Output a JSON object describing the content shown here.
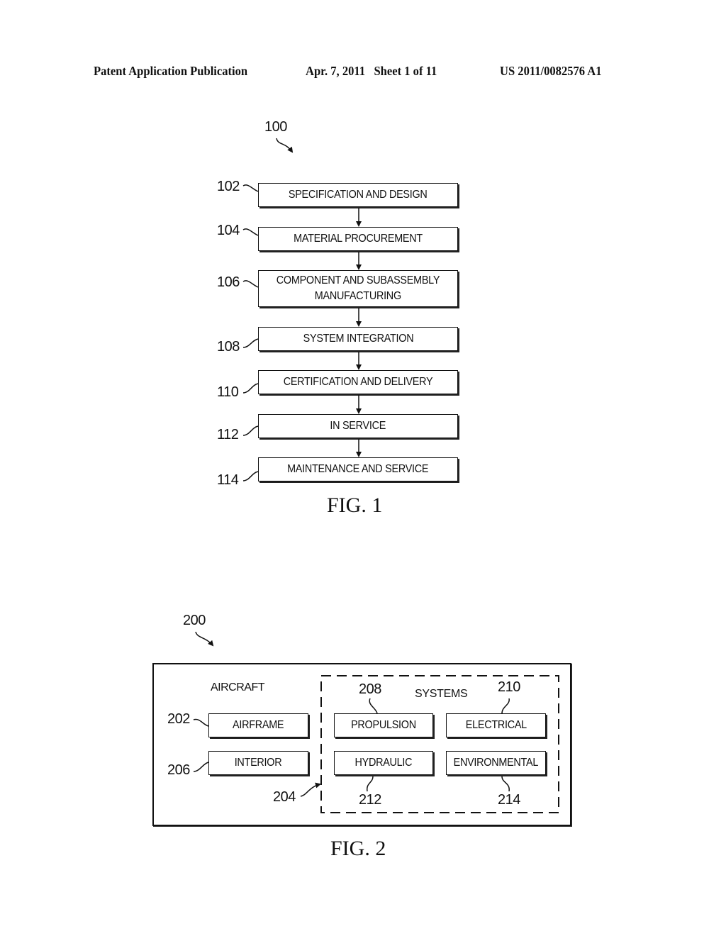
{
  "header": {
    "publication": "Patent Application Publication",
    "date_sheet": "Apr. 7, 2011   Sheet 1 of 11",
    "number": "US 2011/0082576 A1"
  },
  "fig1": {
    "ref": "100",
    "caption": "FIG. 1",
    "steps": [
      {
        "ref": "102",
        "label": "SPECIFICATION AND DESIGN"
      },
      {
        "ref": "104",
        "label": "MATERIAL PROCUREMENT"
      },
      {
        "ref": "106",
        "label": "COMPONENT AND SUBASSEMBLY",
        "label2": "MANUFACTURING"
      },
      {
        "ref": "108",
        "label": "SYSTEM INTEGRATION"
      },
      {
        "ref": "110",
        "label": "CERTIFICATION AND DELIVERY"
      },
      {
        "ref": "112",
        "label": "IN SERVICE"
      },
      {
        "ref": "114",
        "label": "MAINTENANCE AND SERVICE"
      }
    ]
  },
  "fig2": {
    "ref": "200",
    "caption": "FIG. 2",
    "aircraft_label": "AIRCRAFT",
    "systems_label": "SYSTEMS",
    "systems_ref": "204",
    "airframe": {
      "ref": "202",
      "label": "AIRFRAME"
    },
    "interior": {
      "ref": "206",
      "label": "INTERIOR"
    },
    "propulsion": {
      "ref": "208",
      "label": "PROPULSION"
    },
    "electrical": {
      "ref": "210",
      "label": "ELECTRICAL"
    },
    "hydraulic": {
      "ref": "212",
      "label": "HYDRAULIC"
    },
    "environmental": {
      "ref": "214",
      "label": "ENVIRONMENTAL"
    }
  }
}
